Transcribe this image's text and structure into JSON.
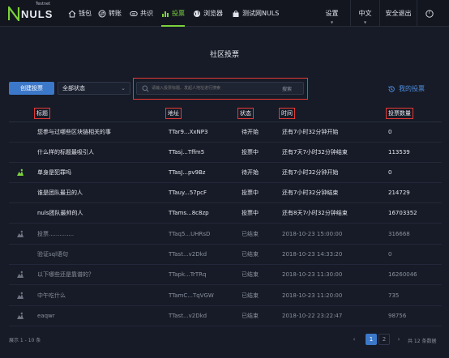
{
  "nav": {
    "logo_text": "NULS",
    "logo_badge": "Testnet",
    "items": [
      {
        "label": "钱包",
        "icon": "home-icon"
      },
      {
        "label": "转账",
        "icon": "transfer-icon"
      },
      {
        "label": "共识",
        "icon": "consensus-icon"
      },
      {
        "label": "投票",
        "icon": "vote-chart-icon",
        "active": true
      },
      {
        "label": "浏览器",
        "icon": "globe-icon"
      },
      {
        "label": "测试网NULS",
        "icon": "bag-icon"
      }
    ],
    "settings": "设置",
    "language": "中文",
    "logout": "安全退出",
    "help": "?",
    "accent": "#7bd13c"
  },
  "page": {
    "title": "社区投票",
    "create_button": "创建投票",
    "status_filter": "全部状态",
    "search_placeholder": "请输入投票标题、发起人地址进行搜索",
    "search_button": "搜索",
    "my_votes": "我的投票"
  },
  "table": {
    "columns": [
      "标题",
      "地址",
      "状态",
      "时间",
      "投票数量"
    ],
    "rows": [
      {
        "icon": "",
        "title": "您参与过哪些区块链相关的事",
        "address": "TTar9...XxNP3",
        "status": "待开始",
        "time": "还有7小时32分钟开始",
        "votes": "0",
        "ended": false
      },
      {
        "icon": "",
        "title": "什么样的标题最吸引人",
        "address": "TTasj...Tffm5",
        "status": "投票中",
        "time": "还有7天7小时32分钟结束",
        "votes": "113539",
        "ended": false
      },
      {
        "icon": "mine-vote-icon",
        "title": "单身是犯罪吗",
        "address": "TTasJ...pv9Bz",
        "status": "待开始",
        "time": "还有7小时32分钟开始",
        "votes": "0",
        "ended": false
      },
      {
        "icon": "",
        "title": "谁是团队最丑的人",
        "address": "TTauy...57pcF",
        "status": "投票中",
        "time": "还有7小时32分钟结束",
        "votes": "214729",
        "ended": false
      },
      {
        "icon": "",
        "title": "nuls团队最帅的人",
        "address": "TTams...8c8zp",
        "status": "投票中",
        "time": "还有8天7小时32分钟结束",
        "votes": "16703352",
        "ended": false
      },
      {
        "icon": "participated-icon",
        "title": "投票..............",
        "address": "TTaq5...UHRsD",
        "status": "已结束",
        "time": "2018-10-23 15:00:00",
        "votes": "316668",
        "ended": true
      },
      {
        "icon": "",
        "title": "验证sql语句",
        "address": "TTast...v2Dkd",
        "status": "已结束",
        "time": "2018-10-23 14:33:20",
        "votes": "0",
        "ended": true
      },
      {
        "icon": "participated-icon",
        "title": "以下哪些还是靠谱的？",
        "address": "TTapk...TrTRq",
        "status": "已结束",
        "time": "2018-10-23 11:30:00",
        "votes": "16260046",
        "ended": true
      },
      {
        "icon": "participated-icon",
        "title": "中午吃什么",
        "address": "TTamC...TqVGW",
        "status": "已结束",
        "time": "2018-10-23 11:20:00",
        "votes": "735",
        "ended": true
      },
      {
        "icon": "participated-icon",
        "title": "eaqwr",
        "address": "TTast...v2Dkd",
        "status": "已结束",
        "time": "2018-10-22 23:22:47",
        "votes": "98756",
        "ended": true
      }
    ]
  },
  "footer": {
    "showing": "展示 1 - 10 条",
    "prev": "‹",
    "pages": [
      "1",
      "2"
    ],
    "current_page": "1",
    "next": "›",
    "total": "共 12 条数据"
  }
}
